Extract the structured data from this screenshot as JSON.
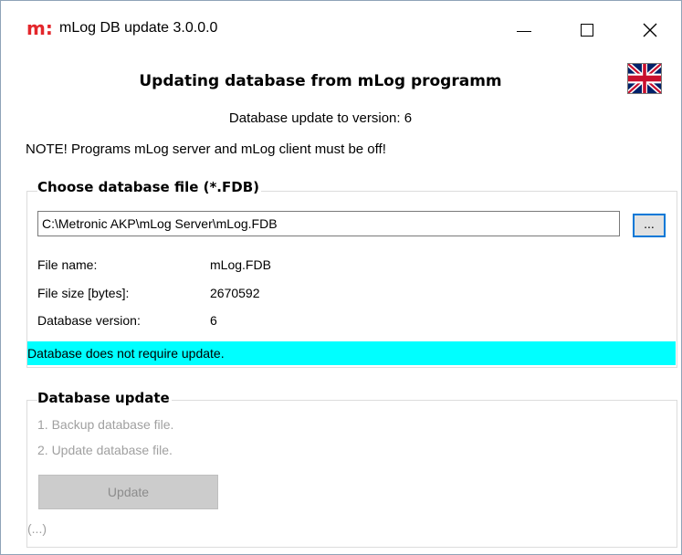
{
  "window": {
    "title": "mLog DB update 3.0.0.0",
    "logo_text": "m:"
  },
  "header": {
    "heading": "Updating database from mLog programm",
    "version_text": "Database update to version: 6",
    "language_flag": "uk-flag-icon"
  },
  "note": "NOTE! Programs mLog server and mLog client must be off!",
  "file_group": {
    "legend": "Choose database file (*.FDB)",
    "path_value": "C:\\Metronic AKP\\mLog Server\\mLog.FDB",
    "browse_label": "...",
    "rows": [
      {
        "label": "File name:",
        "value": "mLog.FDB"
      },
      {
        "label": "File size [bytes]:",
        "value": "2670592"
      },
      {
        "label": "Database version:",
        "value": "6"
      }
    ],
    "status": "Database does not require update.",
    "status_color": "#00ffff"
  },
  "update_group": {
    "legend": "Database update",
    "steps": [
      "1. Backup database file.",
      "2. Update database file."
    ],
    "update_label": "Update",
    "progress_text": "(...)"
  }
}
